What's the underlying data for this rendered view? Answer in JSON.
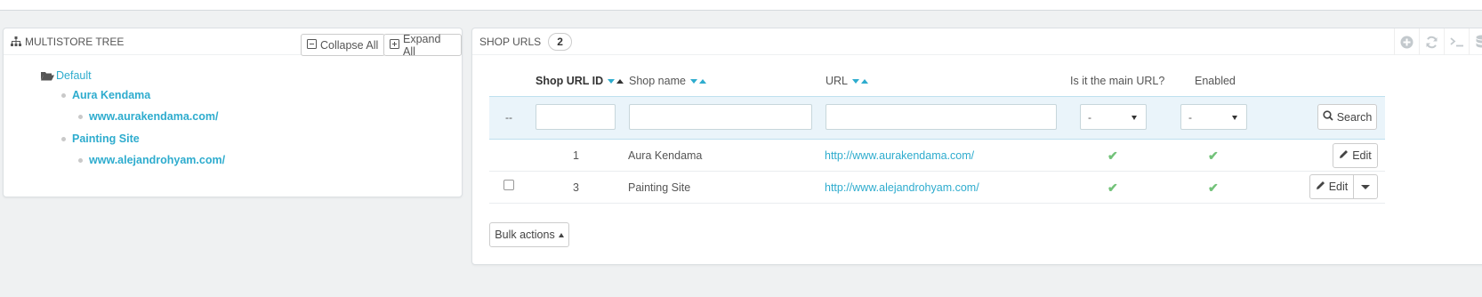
{
  "tree": {
    "title": "MULTISTORE TREE",
    "collapse_label": "Collapse All",
    "expand_label": "Expand All",
    "root": "Default",
    "shops": [
      {
        "name": "Aura Kendama",
        "url": "www.aurakendama.com/"
      },
      {
        "name": "Painting Site",
        "url": "www.alejandrohyam.com/"
      }
    ]
  },
  "urls": {
    "title": "SHOP URLS",
    "count": "2",
    "columns": {
      "id": "Shop URL ID",
      "name": "Shop name",
      "url": "URL",
      "main": "Is it the main URL?",
      "enabled": "Enabled"
    },
    "filter": {
      "bulk_placeholder": "--",
      "main_value": "-",
      "enabled_value": "-",
      "search_label": "Search"
    },
    "rows": [
      {
        "id": "1",
        "name": "Aura Kendama",
        "url": "http://www.aurakendama.com/",
        "edit": "Edit"
      },
      {
        "id": "3",
        "name": "Painting Site",
        "url": "http://www.alejandrohyam.com/",
        "edit": "Edit"
      }
    ],
    "bulk_actions": "Bulk actions"
  },
  "icons": {
    "check": "✔",
    "edit": "pencil-icon",
    "search": "search-icon"
  },
  "colors": {
    "accent": "#2eacce",
    "check": "#72c279",
    "filter_bg": "#eaf4fa"
  }
}
